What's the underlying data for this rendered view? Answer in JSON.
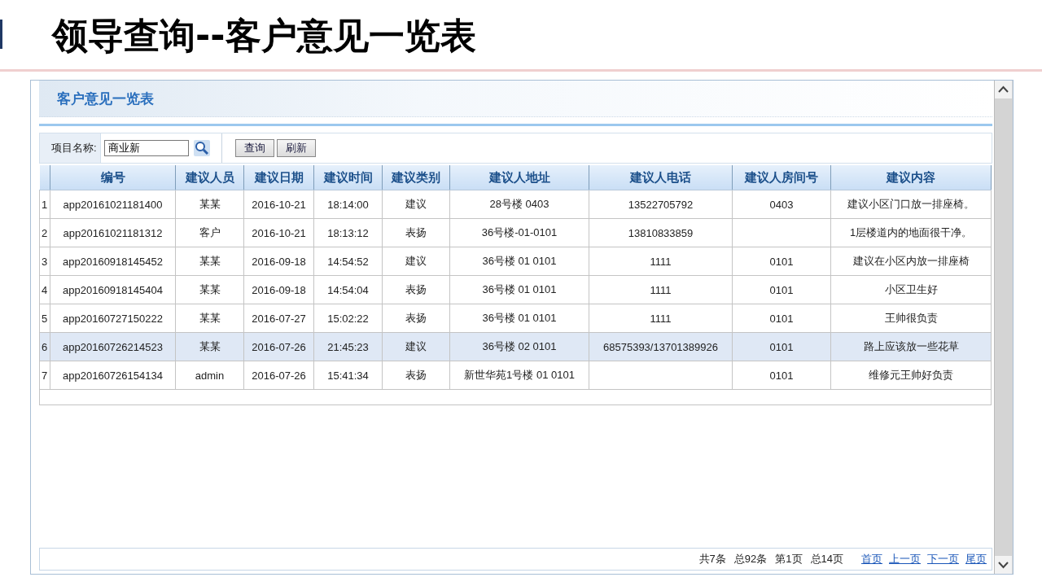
{
  "slide_title": "领导查询--客户意见一览表",
  "panel": {
    "title": "客户意见一览表"
  },
  "search": {
    "label": "项目名称:",
    "value": "商业新",
    "buttons": [
      "查询",
      "刷新"
    ]
  },
  "table": {
    "columns": [
      "编号",
      "建议人员",
      "建议日期",
      "建议时间",
      "建议类别",
      "建议人地址",
      "建议人电话",
      "建议人房间号",
      "建议内容"
    ],
    "rows": [
      {
        "index": "1",
        "cells": [
          "app20161021181400",
          "某某",
          "2016-10-21",
          "18:14:00",
          "建议",
          "28号楼 0403",
          "13522705792",
          "0403",
          "建议小区门口放一排座椅。"
        ],
        "selected": false
      },
      {
        "index": "2",
        "cells": [
          "app20161021181312",
          "客户",
          "2016-10-21",
          "18:13:12",
          "表扬",
          "36号楼-01-0101",
          "13810833859",
          "",
          "1层楼道内的地面很干净。"
        ],
        "selected": false
      },
      {
        "index": "3",
        "cells": [
          "app20160918145452",
          "某某",
          "2016-09-18",
          "14:54:52",
          "建议",
          "36号楼 01 0101",
          "1111",
          "0101",
          "建议在小区内放一排座椅"
        ],
        "selected": false
      },
      {
        "index": "4",
        "cells": [
          "app20160918145404",
          "某某",
          "2016-09-18",
          "14:54:04",
          "表扬",
          "36号楼 01 0101",
          "1111",
          "0101",
          "小区卫生好"
        ],
        "selected": false
      },
      {
        "index": "5",
        "cells": [
          "app20160727150222",
          "某某",
          "2016-07-27",
          "15:02:22",
          "表扬",
          "36号楼 01 0101",
          "1111",
          "0101",
          "王帅很负责"
        ],
        "selected": false
      },
      {
        "index": "6",
        "cells": [
          "app20160726214523",
          "某某",
          "2016-07-26",
          "21:45:23",
          "建议",
          "36号楼 02 0101",
          "68575393/13701389926",
          "0101",
          "路上应该放一些花草"
        ],
        "selected": true
      },
      {
        "index": "7",
        "cells": [
          "app20160726154134",
          "admin",
          "2016-07-26",
          "15:41:34",
          "表扬",
          "新世华苑1号楼 01 0101",
          "",
          "0101",
          "维修元王帅好负责"
        ],
        "selected": false
      }
    ]
  },
  "pager": {
    "info": [
      "共7条",
      "总92条",
      "第1页",
      "总14页"
    ],
    "links": [
      "首页",
      "上一页",
      "下一页",
      "尾页"
    ]
  }
}
